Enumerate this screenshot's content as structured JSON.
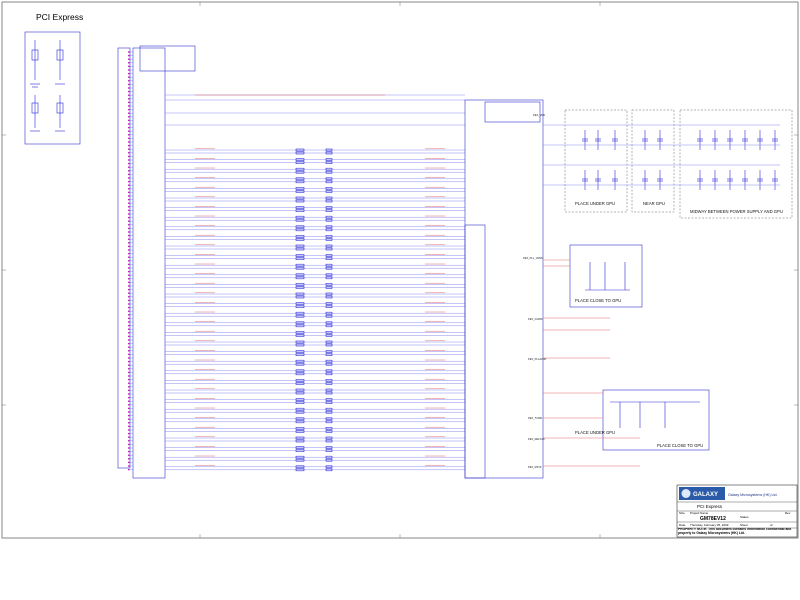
{
  "sheet": {
    "title": "PCI Express",
    "notes": {
      "place_under_gpu_1": "PLACE UNDER GPU",
      "near_gpu": "NEAR GPU",
      "midway": "MIDWAY BETWEEN POWER SUPPLY AND GPU",
      "place_close_gpu_1": "PLACE CLOSE TO GPU",
      "place_under_gpu_2": "PLACE UNDER GPU",
      "place_close_gpu_2": "PLACE CLOSE TO GPU"
    }
  },
  "nets": {
    "pex_vdd": "PEX_VDD",
    "pex_pll_hvdd": "PEX_PLL_HVDD",
    "pex_ioarf": "PEX_IOARF",
    "pex_pllavdd": "PEX_PLLAVDD",
    "pex_tcrif": "PEX_TCRIF",
    "pex_refclk": "PEX_REFCLK",
    "pex_rst": "PEX_RST#"
  },
  "title_block": {
    "company": "Galaxy Microsystems (HK) Ltd.",
    "logo": "GALAXY",
    "sheet_title": "PCI Express",
    "size_label": "Size",
    "project_label": "Project Name",
    "rev_label": "Rev",
    "model": "GM78EV12",
    "status_label": "Status",
    "date_label": "Date",
    "date": "Thursday, February 05, 2009",
    "sheet_label": "Sheet",
    "of_label": "of",
    "notice": "PROPERTY NOTE: This document contains information confidential and property to Galaxy Microsystems (HK) Ltd."
  }
}
